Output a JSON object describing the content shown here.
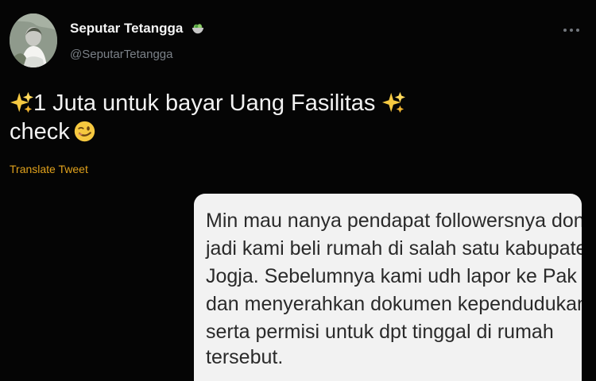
{
  "tweet": {
    "author": {
      "name": "Seputar Tetangga",
      "handle": "@SeputarTetangga",
      "avatar_icon": "avatar-icon",
      "badge_icon": "salad-icon"
    },
    "more_options_icon": "more-options-icon",
    "text": {
      "line1": "1 Juta untuk bayar Uang Fasilitas",
      "line2": "check",
      "emoji_icons": [
        "sparkles-icon",
        "winking-face-icon"
      ]
    },
    "translate_label": "Translate Tweet"
  },
  "media": {
    "lines": [
      "Min mau nanya pendapat followersnya dong,",
      "jadi kami beli rumah di salah satu kabupaten di",
      "Jogja. Sebelumnya kami udh lapor ke Pak RT",
      "dan menyerahkan dokumen kependudukan,",
      "serta permisi untuk dpt tinggal di rumah",
      "tersebut."
    ]
  },
  "colors": {
    "background": "#050505",
    "primary_text": "#f2f2f2",
    "secondary_text": "#7b8188",
    "translate_link": "#e0a11c",
    "media_background": "#f2f2f2",
    "media_text": "#2a2a2a"
  }
}
